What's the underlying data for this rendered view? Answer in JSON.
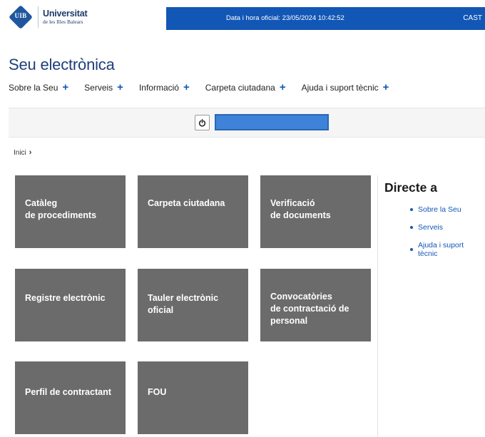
{
  "header": {
    "logo_abbr": "UIB",
    "logo_name": "Universitat",
    "logo_subtitle": "de les Illes Balears",
    "datetime": "Data i hora oficial: 23/05/2024  10:42:52",
    "language": "CAST"
  },
  "site_title": "Seu electrònica",
  "nav": [
    {
      "label": "Sobre la Seu"
    },
    {
      "label": "Serveis"
    },
    {
      "label": "Informació"
    },
    {
      "label": "Carpeta ciutadana"
    },
    {
      "label": "Ajuda i suport tècnic"
    }
  ],
  "icons": {
    "power": "power-icon",
    "expand": "plus-icon",
    "breadcrumb_sep": "chevron-right-icon"
  },
  "breadcrumb": {
    "home": "Inici"
  },
  "tiles": [
    {
      "label": "Catàleg\nde procediments"
    },
    {
      "label": "Carpeta ciutadana"
    },
    {
      "label": "Verificació\nde documents"
    },
    {
      "label": "Registre electrònic"
    },
    {
      "label": "Tauler electrònic oficial"
    },
    {
      "label": "Convocatòries\nde contractació de\npersonal"
    },
    {
      "label": "Perfil de contractant"
    },
    {
      "label": "FOU"
    }
  ],
  "directe": {
    "title": "Directe a",
    "links": [
      "Sobre la Seu",
      "Serveis",
      "Ajuda i suport tècnic"
    ]
  },
  "colors": {
    "brand_blue": "#1257b5",
    "tile_gray": "#6b6b6b",
    "title_blue": "#1e3f7a"
  }
}
